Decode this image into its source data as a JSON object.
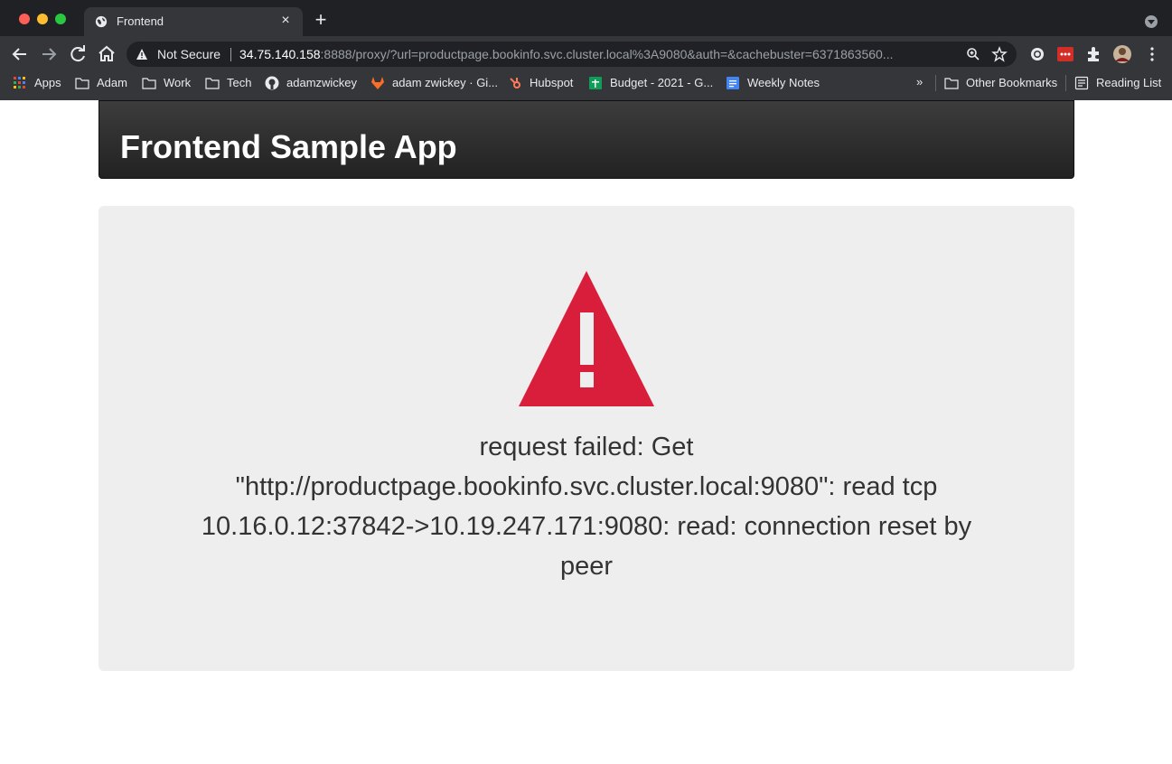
{
  "browser": {
    "tab_title": "Frontend",
    "new_tab_label": "+",
    "close_tab_label": "×",
    "security_label": "Not Secure",
    "url_host": "34.75.140.158",
    "url_rest": ":8888/proxy/?url=productpage.bookinfo.svc.cluster.local%3A9080&auth=&cachebuster=6371863560..."
  },
  "bookmarks": {
    "items": [
      {
        "label": "Apps",
        "icon": "apps-grid-icon"
      },
      {
        "label": "Adam",
        "icon": "folder-icon"
      },
      {
        "label": "Work",
        "icon": "folder-icon"
      },
      {
        "label": "Tech",
        "icon": "folder-icon"
      },
      {
        "label": "adamzwickey",
        "icon": "github-icon"
      },
      {
        "label": "adam zwickey · Gi...",
        "icon": "gitlab-icon"
      },
      {
        "label": "Hubspot",
        "icon": "hubspot-icon"
      },
      {
        "label": "Budget - 2021 - G...",
        "icon": "sheets-icon"
      },
      {
        "label": "Weekly Notes",
        "icon": "docs-icon"
      }
    ],
    "overflow_label": "»",
    "other_bookmarks": "Other Bookmarks",
    "reading_list": "Reading List"
  },
  "app": {
    "title": "Frontend Sample App",
    "error_message": "request failed: Get \"http://productpage.bookinfo.svc.cluster.local:9080\": read tcp 10.16.0.12:37842->10.19.247.171:9080: read: connection reset by peer",
    "alert_color": "#d81e3a"
  }
}
